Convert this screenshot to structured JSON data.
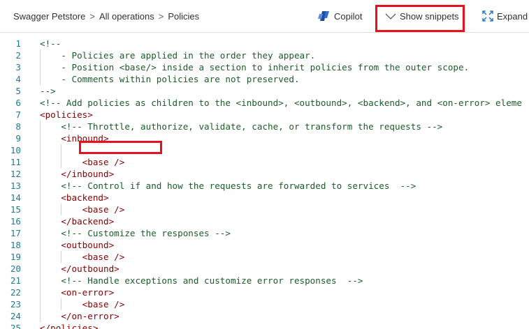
{
  "breadcrumb": {
    "items": [
      "Swagger Petstore",
      "All operations",
      "Policies"
    ],
    "separator": ">"
  },
  "toolbar": {
    "copilot_label": "Copilot",
    "snippets_label": "Show snippets",
    "expand_label": "Expand"
  },
  "colors": {
    "highlight": "#e8101e",
    "line_number": "#237893",
    "tag": "#800000",
    "comment": "#1c5b2a",
    "copilot_blue": "#1f4e9c"
  },
  "icons": {
    "copilot": "copilot-icon",
    "snippets": "chevron-down-icon",
    "expand": "expand-icon"
  },
  "editor": {
    "lines": [
      {
        "n": "1",
        "text": "<!--"
      },
      {
        "n": "2",
        "text": "    - Policies are applied in the order they appear."
      },
      {
        "n": "3",
        "text": "    - Position <base/> inside a section to inherit policies from the outer scope."
      },
      {
        "n": "4",
        "text": "    - Comments within policies are not preserved."
      },
      {
        "n": "5",
        "text": "-->"
      },
      {
        "n": "6",
        "text": "<!-- Add policies as children to the <inbound>, <outbound>, <backend>, and <on-error> eleme"
      },
      {
        "n": "7",
        "text": "<policies>"
      },
      {
        "n": "8",
        "text": "    <!-- Throttle, authorize, validate, cache, or transform the requests -->"
      },
      {
        "n": "9",
        "text": "    <inbound>"
      },
      {
        "n": "10",
        "text": ""
      },
      {
        "n": "11",
        "text": "        <base />"
      },
      {
        "n": "12",
        "text": "    </inbound>"
      },
      {
        "n": "13",
        "text": "    <!-- Control if and how the requests are forwarded to services  -->"
      },
      {
        "n": "14",
        "text": "    <backend>"
      },
      {
        "n": "15",
        "text": "        <base />"
      },
      {
        "n": "16",
        "text": "    </backend>"
      },
      {
        "n": "17",
        "text": "    <!-- Customize the responses -->"
      },
      {
        "n": "18",
        "text": "    <outbound>"
      },
      {
        "n": "19",
        "text": "        <base />"
      },
      {
        "n": "20",
        "text": "    </outbound>"
      },
      {
        "n": "21",
        "text": "    <!-- Handle exceptions and customize error responses  -->"
      },
      {
        "n": "22",
        "text": "    <on-error>"
      },
      {
        "n": "23",
        "text": "        <base />"
      },
      {
        "n": "24",
        "text": "    </on-error>"
      },
      {
        "n": "25",
        "text": "</policies>"
      }
    ]
  }
}
